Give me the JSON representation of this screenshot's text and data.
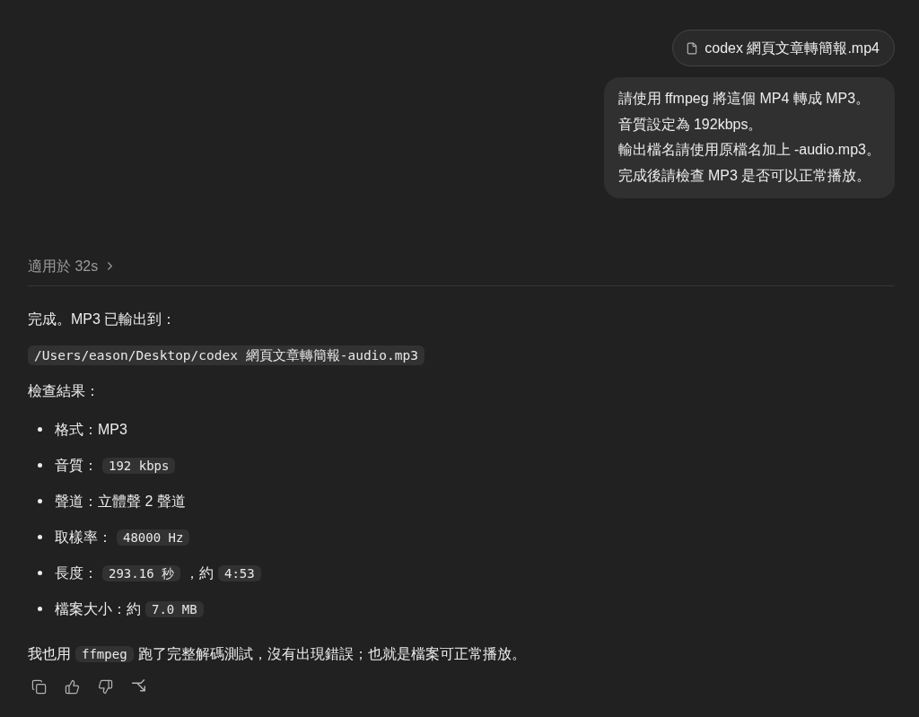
{
  "attachment": {
    "filename": "codex 網頁文章轉簡報.mp4"
  },
  "user_message": {
    "lines": [
      "請使用 ffmpeg 將這個 MP4 轉成 MP3。",
      "音質設定為 192kbps。",
      "輸出檔名請使用原檔名加上 -audio.mp3。",
      "完成後請檢查 MP3 是否可以正常播放。"
    ]
  },
  "thinking_status": {
    "label": "適用於 32s"
  },
  "response": {
    "blocks": [
      {
        "kind": "paragraph",
        "segments": [
          {
            "kind": "text",
            "text": "完成。MP3 已輸出到："
          }
        ]
      },
      {
        "kind": "code_block",
        "text": "/Users/eason/Desktop/codex 網頁文章轉簡報-audio.mp3"
      },
      {
        "kind": "paragraph",
        "segments": [
          {
            "kind": "text",
            "text": "檢查結果："
          }
        ]
      },
      {
        "kind": "list",
        "items": [
          {
            "segments": [
              {
                "kind": "text",
                "text": "格式：MP3"
              }
            ]
          },
          {
            "segments": [
              {
                "kind": "text",
                "text": "音質："
              },
              {
                "kind": "code",
                "text": "192 kbps"
              }
            ]
          },
          {
            "segments": [
              {
                "kind": "text",
                "text": "聲道：立體聲 2 聲道"
              }
            ]
          },
          {
            "segments": [
              {
                "kind": "text",
                "text": "取樣率："
              },
              {
                "kind": "code",
                "text": "48000 Hz"
              }
            ]
          },
          {
            "segments": [
              {
                "kind": "text",
                "text": "長度："
              },
              {
                "kind": "code",
                "text": "293.16 秒"
              },
              {
                "kind": "text",
                "text": "，約"
              },
              {
                "kind": "code",
                "text": "4:53"
              }
            ]
          },
          {
            "segments": [
              {
                "kind": "text",
                "text": "檔案大小：約"
              },
              {
                "kind": "code",
                "text": "7.0 MB"
              }
            ]
          }
        ]
      },
      {
        "kind": "paragraph",
        "segments": [
          {
            "kind": "text",
            "text": "我也用"
          },
          {
            "kind": "code",
            "text": "ffmpeg"
          },
          {
            "kind": "text",
            "text": "跑了完整解碼測試，沒有出現錯誤；也就是檔案可正常播放。"
          }
        ]
      }
    ]
  }
}
